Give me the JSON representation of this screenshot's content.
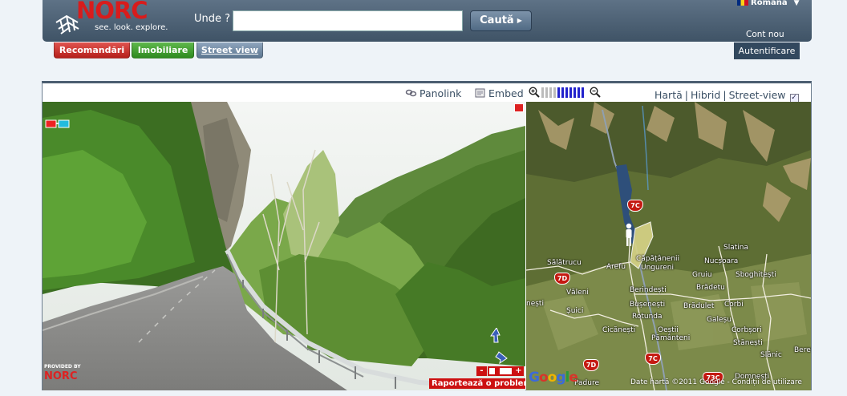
{
  "header": {
    "logo_text": "NORC",
    "logo_tagline": "see. look. explore.",
    "search_label": "Unde ?",
    "search_value": "",
    "search_button": "Caută",
    "language": "Română",
    "new_account": "Cont nou"
  },
  "tabs": [
    {
      "label": "Recomandări"
    },
    {
      "label": "Imobiliare"
    },
    {
      "label": "Street view"
    }
  ],
  "login_label": "Autentificare",
  "pano": {
    "panolink_label": "Panolink",
    "embed_label": "Embed",
    "provided_by": "PROVIDED BY",
    "provided_logo": "NORC",
    "report_problem": "Raportează o problemă",
    "zoom_out": "-",
    "zoom_in": "+"
  },
  "map": {
    "types": [
      "Hartă",
      "Hibrid",
      "Street-view"
    ],
    "street_view_checked": true,
    "google_logo": "Google",
    "copyright": "Date hartă ©2011 Google - Condiții de utilizare",
    "places": [
      {
        "name": "Sălătrucu"
      },
      {
        "name": "Căpățânenii"
      },
      {
        "name": "Ungureni"
      },
      {
        "name": "Arefu"
      },
      {
        "name": "Slatina"
      },
      {
        "name": "Nucșoara"
      },
      {
        "name": "Gruiu"
      },
      {
        "name": "Sboghitești"
      },
      {
        "name": "Brădetu"
      },
      {
        "name": "Berindești"
      },
      {
        "name": "Văleni"
      },
      {
        "name": "Bușenești"
      },
      {
        "name": "Brădulet"
      },
      {
        "name": "Corbi"
      },
      {
        "name": "Șuici"
      },
      {
        "name": "Rotunda"
      },
      {
        "name": "Galeșu"
      },
      {
        "name": "Cicănești"
      },
      {
        "name": "Oeștii"
      },
      {
        "name": "Corbșori"
      },
      {
        "name": "Pământeni"
      },
      {
        "name": "Stănești"
      },
      {
        "name": "Slănic"
      },
      {
        "name": "Berev"
      },
      {
        "name": "Padure"
      },
      {
        "name": "Domnești"
      },
      {
        "name": "nești"
      }
    ],
    "road_shields": [
      "7C",
      "7D",
      "7C",
      "7D",
      "73C"
    ]
  }
}
